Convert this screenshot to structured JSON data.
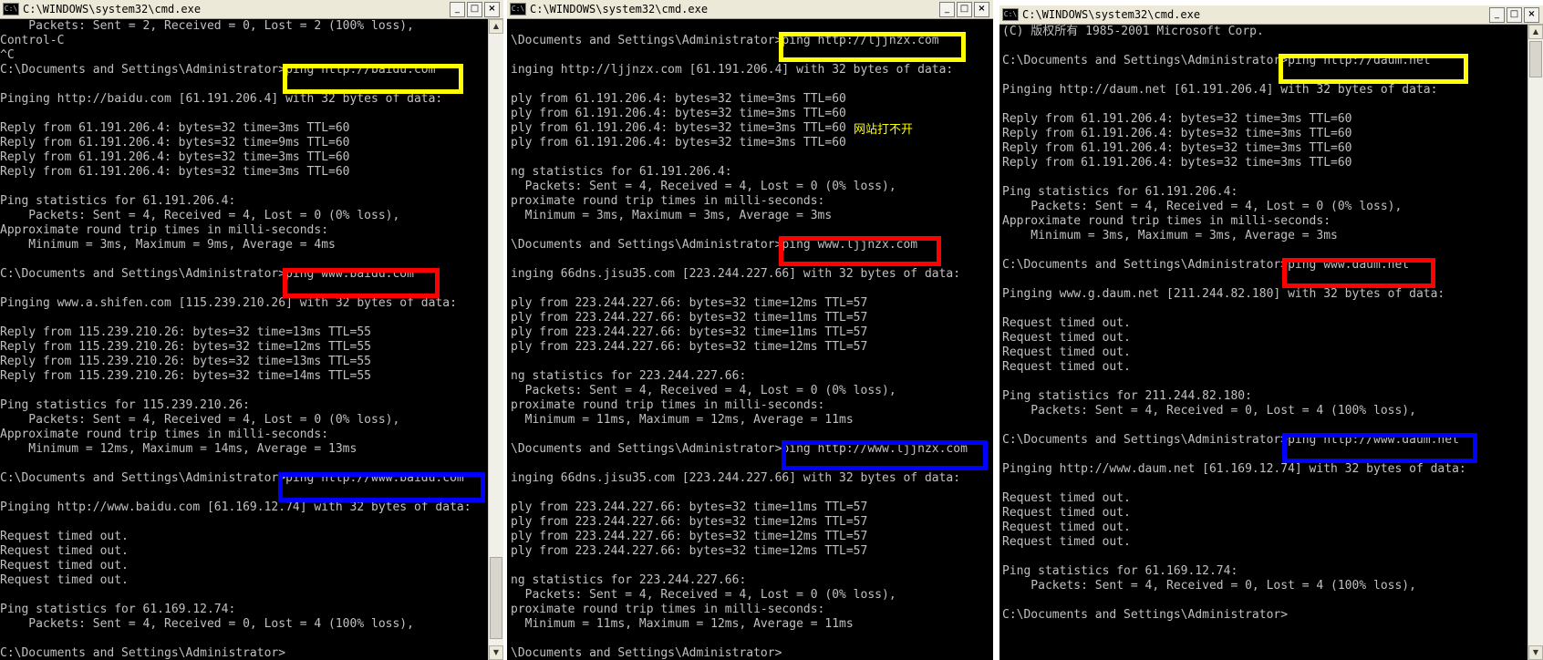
{
  "windows": [
    {
      "title": "C:\\WINDOWS\\system32\\cmd.exe",
      "icon": "C:\\",
      "lines": [
        "    Packets: Sent = 2, Received = 0, Lost = 2 (100% loss),",
        "Control-C",
        "^C",
        "C:\\Documents and Settings\\Administrator>ping http://baidu.com",
        "",
        "Pinging http://baidu.com [61.191.206.4] with 32 bytes of data:",
        "",
        "Reply from 61.191.206.4: bytes=32 time=3ms TTL=60",
        "Reply from 61.191.206.4: bytes=32 time=9ms TTL=60",
        "Reply from 61.191.206.4: bytes=32 time=3ms TTL=60",
        "Reply from 61.191.206.4: bytes=32 time=3ms TTL=60",
        "",
        "Ping statistics for 61.191.206.4:",
        "    Packets: Sent = 4, Received = 4, Lost = 0 (0% loss),",
        "Approximate round trip times in milli-seconds:",
        "    Minimum = 3ms, Maximum = 9ms, Average = 4ms",
        "",
        "C:\\Documents and Settings\\Administrator>ping www.baidu.com",
        "",
        "Pinging www.a.shifen.com [115.239.210.26] with 32 bytes of data:",
        "",
        "Reply from 115.239.210.26: bytes=32 time=13ms TTL=55",
        "Reply from 115.239.210.26: bytes=32 time=12ms TTL=55",
        "Reply from 115.239.210.26: bytes=32 time=13ms TTL=55",
        "Reply from 115.239.210.26: bytes=32 time=14ms TTL=55",
        "",
        "Ping statistics for 115.239.210.26:",
        "    Packets: Sent = 4, Received = 4, Lost = 0 (0% loss),",
        "Approximate round trip times in milli-seconds:",
        "    Minimum = 12ms, Maximum = 14ms, Average = 13ms",
        "",
        "C:\\Documents and Settings\\Administrator>ping http://www.baidu.com",
        "",
        "Pinging http://www.baidu.com [61.169.12.74] with 32 bytes of data:",
        "",
        "Request timed out.",
        "Request timed out.",
        "Request timed out.",
        "Request timed out.",
        "",
        "Ping statistics for 61.169.12.74:",
        "    Packets: Sent = 4, Received = 0, Lost = 4 (100% loss),",
        "",
        "C:\\Documents and Settings\\Administrator>"
      ]
    },
    {
      "title": "C:\\WINDOWS\\system32\\cmd.exe",
      "icon": "C:\\",
      "annotation": "网站打不开",
      "lines": [
        "",
        "\\Documents and Settings\\Administrator>ping http://ljjnzx.com",
        "",
        "inging http://ljjnzx.com [61.191.206.4] with 32 bytes of data:",
        "",
        "ply from 61.191.206.4: bytes=32 time=3ms TTL=60",
        "ply from 61.191.206.4: bytes=32 time=3ms TTL=60",
        "ply from 61.191.206.4: bytes=32 time=3ms TTL=60",
        "ply from 61.191.206.4: bytes=32 time=3ms TTL=60",
        "",
        "ng statistics for 61.191.206.4:",
        "  Packets: Sent = 4, Received = 4, Lost = 0 (0% loss),",
        "proximate round trip times in milli-seconds:",
        "  Minimum = 3ms, Maximum = 3ms, Average = 3ms",
        "",
        "\\Documents and Settings\\Administrator>ping www.ljjnzx.com",
        "",
        "inging 66dns.jisu35.com [223.244.227.66] with 32 bytes of data:",
        "",
        "ply from 223.244.227.66: bytes=32 time=12ms TTL=57",
        "ply from 223.244.227.66: bytes=32 time=11ms TTL=57",
        "ply from 223.244.227.66: bytes=32 time=11ms TTL=57",
        "ply from 223.244.227.66: bytes=32 time=12ms TTL=57",
        "",
        "ng statistics for 223.244.227.66:",
        "  Packets: Sent = 4, Received = 4, Lost = 0 (0% loss),",
        "proximate round trip times in milli-seconds:",
        "  Minimum = 11ms, Maximum = 12ms, Average = 11ms",
        "",
        "\\Documents and Settings\\Administrator>ping http://www.ljjnzx.com",
        "",
        "inging 66dns.jisu35.com [223.244.227.66] with 32 bytes of data:",
        "",
        "ply from 223.244.227.66: bytes=32 time=11ms TTL=57",
        "ply from 223.244.227.66: bytes=32 time=12ms TTL=57",
        "ply from 223.244.227.66: bytes=32 time=12ms TTL=57",
        "ply from 223.244.227.66: bytes=32 time=12ms TTL=57",
        "",
        "ng statistics for 223.244.227.66:",
        "  Packets: Sent = 4, Received = 4, Lost = 0 (0% loss),",
        "proximate round trip times in milli-seconds:",
        "  Minimum = 11ms, Maximum = 12ms, Average = 11ms",
        "",
        "\\Documents and Settings\\Administrator>"
      ]
    },
    {
      "title": "C:\\WINDOWS\\system32\\cmd.exe",
      "icon": "C:\\",
      "lines": [
        "(C) 版权所有 1985-2001 Microsoft Corp.",
        "",
        "C:\\Documents and Settings\\Administrator>ping http://daum.net",
        "",
        "Pinging http://daum.net [61.191.206.4] with 32 bytes of data:",
        "",
        "Reply from 61.191.206.4: bytes=32 time=3ms TTL=60",
        "Reply from 61.191.206.4: bytes=32 time=3ms TTL=60",
        "Reply from 61.191.206.4: bytes=32 time=3ms TTL=60",
        "Reply from 61.191.206.4: bytes=32 time=3ms TTL=60",
        "",
        "Ping statistics for 61.191.206.4:",
        "    Packets: Sent = 4, Received = 4, Lost = 0 (0% loss),",
        "Approximate round trip times in milli-seconds:",
        "    Minimum = 3ms, Maximum = 3ms, Average = 3ms",
        "",
        "C:\\Documents and Settings\\Administrator>ping www.daum.net",
        "",
        "Pinging www.g.daum.net [211.244.82.180] with 32 bytes of data:",
        "",
        "Request timed out.",
        "Request timed out.",
        "Request timed out.",
        "Request timed out.",
        "",
        "Ping statistics for 211.244.82.180:",
        "    Packets: Sent = 4, Received = 0, Lost = 4 (100% loss),",
        "",
        "C:\\Documents and Settings\\Administrator>ping http://www.daum.net",
        "",
        "Pinging http://www.daum.net [61.169.12.74] with 32 bytes of data:",
        "",
        "Request timed out.",
        "Request timed out.",
        "Request timed out.",
        "Request timed out.",
        "",
        "Ping statistics for 61.169.12.74:",
        "    Packets: Sent = 4, Received = 0, Lost = 4 (100% loss),",
        "",
        "C:\\Documents and Settings\\Administrator>"
      ]
    }
  ],
  "colors": {
    "highlight_yellow": "#ffff00",
    "highlight_red": "#ff0000",
    "highlight_blue": "#0000ff",
    "console_text": "#c0c0c0",
    "console_bg": "#000000"
  },
  "icons": [
    "cmd-icon",
    "minimize-icon",
    "maximize-icon",
    "close-icon"
  ]
}
